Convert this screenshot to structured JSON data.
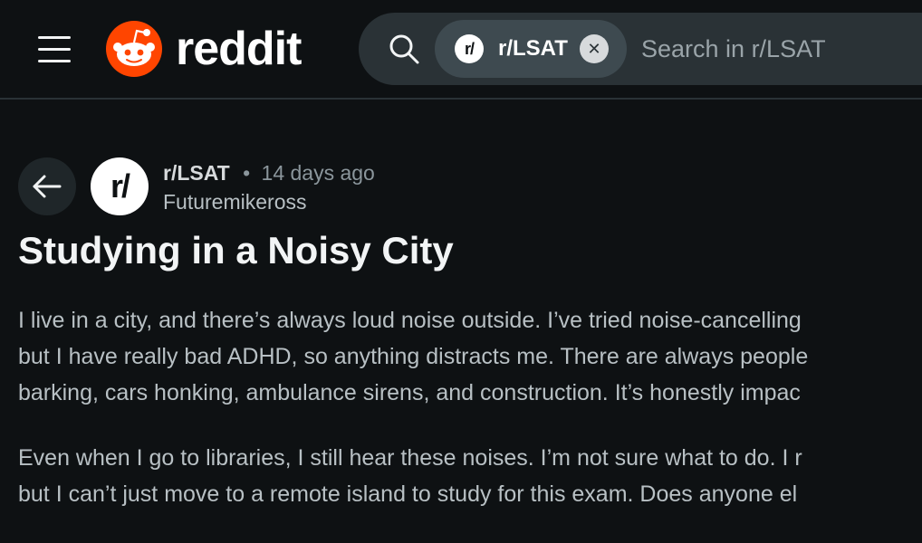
{
  "header": {
    "logo_text": "reddit",
    "brand_color": "#ff4500",
    "menu_icon": "hamburger-menu-icon",
    "search": {
      "icon": "search-icon",
      "scope_avatar_text": "r/",
      "scope_label": "r/LSAT",
      "scope_close_icon": "close-icon",
      "placeholder": "Search in r/LSAT",
      "value": ""
    }
  },
  "post": {
    "back_icon": "arrow-left-icon",
    "subreddit_avatar_text": "r/",
    "subreddit": "r/LSAT",
    "separator": "•",
    "time": "14 days ago",
    "author": "Futuremikeross",
    "title": "Studying in a Noisy City",
    "paragraphs": [
      {
        "lines": [
          "I live in a city, and there’s always loud noise outside. I’ve tried noise-cancelling",
          "but I have really bad ADHD, so anything distracts me. There are always people",
          "barking, cars honking, ambulance sirens, and construction. It’s honestly impac"
        ]
      },
      {
        "lines": [
          "Even when I go to libraries, I still hear these noises. I’m not sure what to do. I r",
          "but I can’t just move to a remote island to study for this exam. Does anyone el"
        ]
      }
    ]
  }
}
